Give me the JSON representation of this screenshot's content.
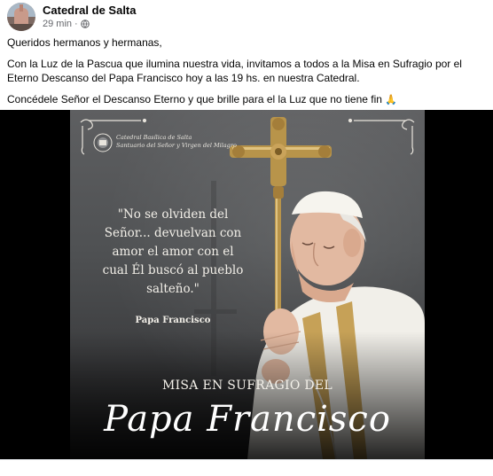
{
  "post": {
    "page_name": "Catedral de Salta",
    "time": "29 min",
    "separator": "·",
    "privacy_icon": "globe-icon",
    "text": {
      "p1": "Queridos hermanos y hermanas,",
      "p2": "Con la Luz de la Pascua que ilumina nuestra vida, invitamos a todos a la Misa en Sufragio por el Eterno Descanso del Papa Francisco hoy a las 19 hs. en nuestra Catedral.",
      "p3": "Concédele Señor el Descanso Eterno y que brille para el la Luz que no tiene fin",
      "p3_emoji": "🙏"
    }
  },
  "poster": {
    "org_line1": "Catedral Basílica de Salta",
    "org_line2": "Santuario del Señor y Virgen del Milagro",
    "quote": "\"No se olviden del Señor... devuelvan con amor el amor con el cual Él buscó al pueblo salteño.\"",
    "quote_author": "Papa Francisco",
    "event": "MISA EN SUFRAGIO DEL",
    "name": "Papa Francisco"
  },
  "colors": {
    "page_name": "#050505",
    "meta": "#65676b",
    "poster_bg": "#4f5153",
    "gold": "#b8944a"
  }
}
